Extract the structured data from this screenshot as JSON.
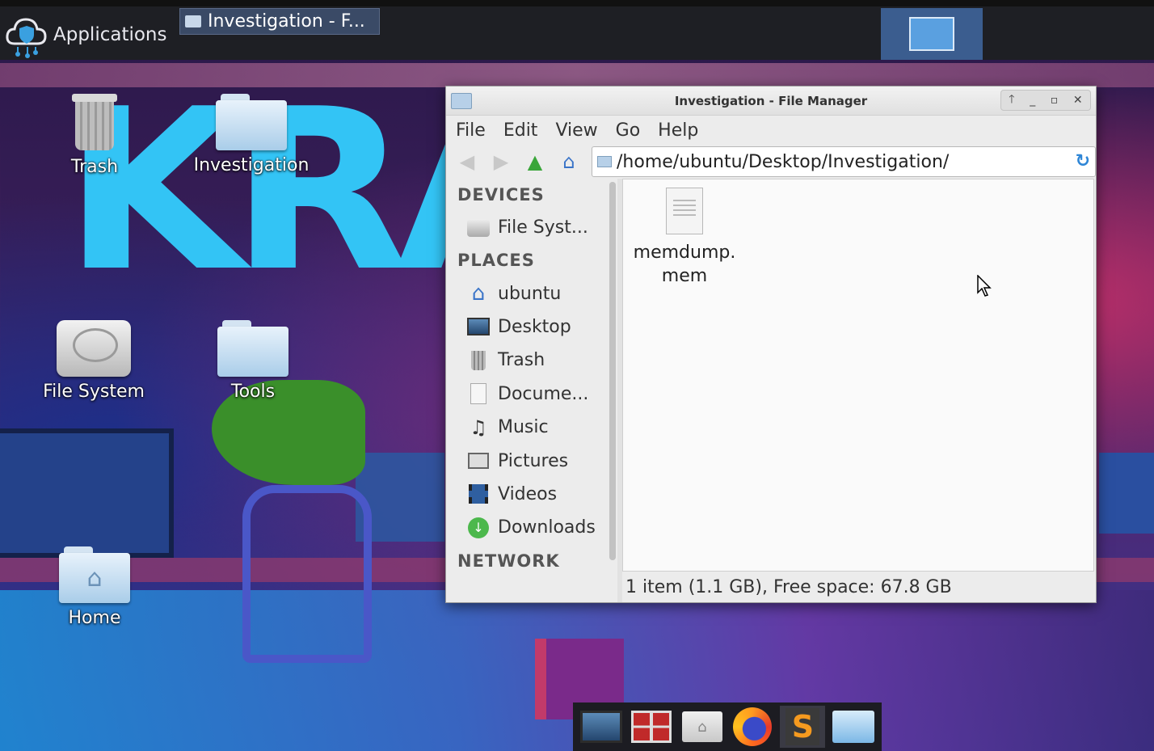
{
  "panel": {
    "applications_label": "Applications",
    "task_title": "Investigation - F..."
  },
  "wallpaper": {
    "text": "KRAM"
  },
  "desktop_icons": {
    "trash": "Trash",
    "investigation": "Investigation",
    "file_system": "File System",
    "tools": "Tools",
    "home": "Home"
  },
  "window": {
    "title": "Investigation - File Manager",
    "controls": {
      "up": "🡑",
      "minimize": "_",
      "maximize": "▫",
      "close": "✕"
    }
  },
  "menu": {
    "file": "File",
    "edit": "Edit",
    "view": "View",
    "go": "Go",
    "help": "Help"
  },
  "location": {
    "path": "/home/ubuntu/Desktop/Investigation/"
  },
  "sidebar": {
    "devices_header": "DEVICES",
    "devices": [
      {
        "label": "File Syst...",
        "icon": "hard-drive-icon"
      }
    ],
    "places_header": "PLACES",
    "places": [
      {
        "label": "ubuntu",
        "icon": "home-icon"
      },
      {
        "label": "Desktop",
        "icon": "desktop-icon"
      },
      {
        "label": "Trash",
        "icon": "trash-icon"
      },
      {
        "label": "Docume...",
        "icon": "document-icon"
      },
      {
        "label": "Music",
        "icon": "music-icon"
      },
      {
        "label": "Pictures",
        "icon": "pictures-icon"
      },
      {
        "label": "Videos",
        "icon": "videos-icon"
      },
      {
        "label": "Downloads",
        "icon": "downloads-icon"
      }
    ],
    "network_header": "NETWORK"
  },
  "content": {
    "files": [
      {
        "name_line1": "memdump.",
        "name_line2": "mem",
        "icon": "document-icon"
      }
    ]
  },
  "statusbar": {
    "text": "1 item (1.1 GB), Free space: 67.8 GB"
  },
  "colors": {
    "accent": "#3b5d8f",
    "wallpaper_text": "#33c4f5"
  }
}
